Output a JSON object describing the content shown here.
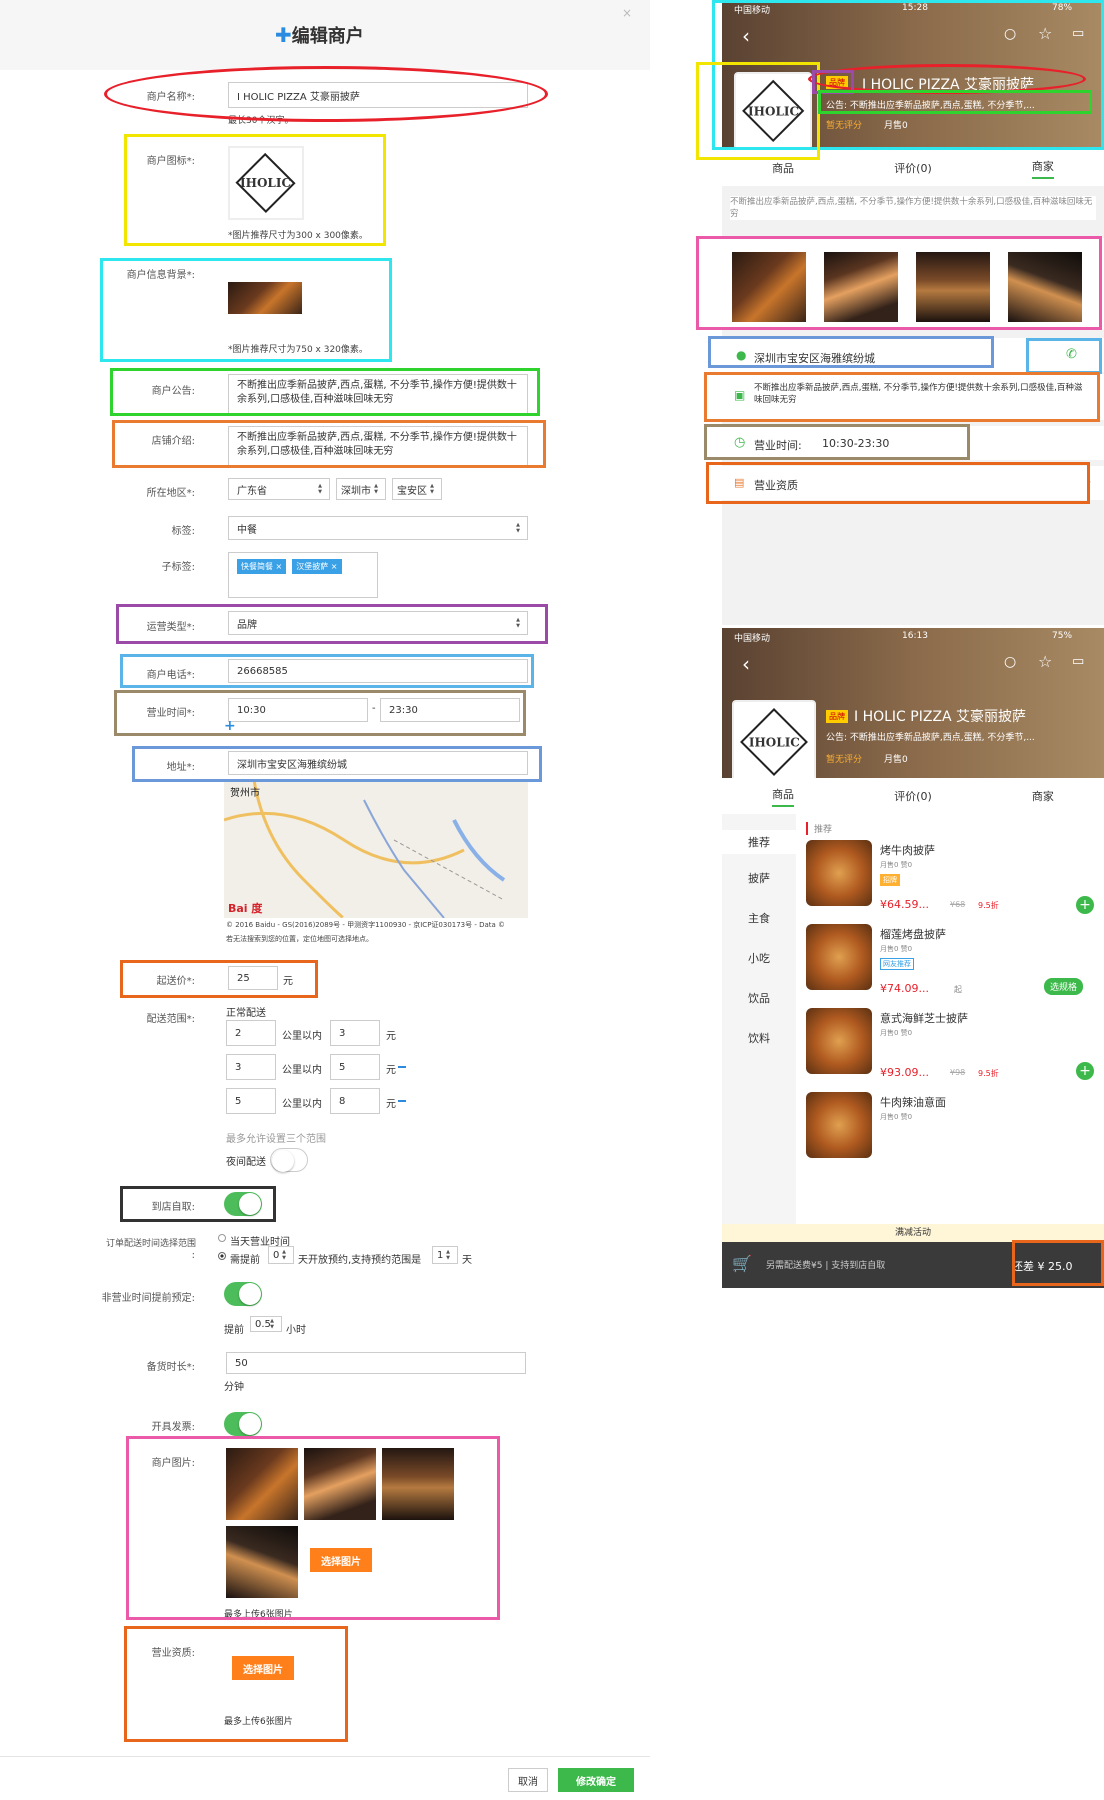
{
  "form": {
    "title": "编辑商户",
    "close": "×",
    "name_label": "商户名称*:",
    "name_value": "I HOLIC PIZZA 艾豪丽披萨",
    "name_hint": "最长30个汉字。",
    "icon_label": "商户图标*:",
    "icon_hint": "*图片推荐尺寸为300 x 300像素。",
    "bg_label": "商户信息背景*:",
    "bg_hint": "*图片推荐尺寸为750 x 320像素。",
    "notice_label": "商户公告:",
    "notice_value": "不断推出应季新品披萨,西点,蛋糕, 不分季节,操作方便!提供数十余系列,口感极佳,百种滋味回味无穷",
    "intro_label": "店铺介绍:",
    "intro_value": "不断推出应季新品披萨,西点,蛋糕, 不分季节,操作方便!提供数十余系列,口感极佳,百种滋味回味无穷",
    "region_label": "所在地区*:",
    "province": "广东省",
    "city": "深圳市",
    "district": "宝安区",
    "tag_label": "标签:",
    "tag_value": "中餐",
    "subtag_label": "子标签:",
    "subtag1": "快餐简餐",
    "subtag2": "汉堡披萨",
    "optype_label": "运营类型*:",
    "optype_value": "品牌",
    "phone_label": "商户电话*:",
    "phone_value": "26668585",
    "hours_label": "营业时间*:",
    "hours_start": "10:30",
    "hours_sep": "-",
    "hours_end": "23:30",
    "hours_add": "+",
    "addr_label": "地址*:",
    "addr_value": "深圳市宝安区海雅缤纷城",
    "map_city": "贺州市",
    "map_copyright": "© 2016 Baidu - GS(2016)2089号 - 甲测资字1100930 - 京ICP证030173号 - Data ©",
    "map_hint": "若无法搜索到您的位置，定位地图可选择地点。",
    "map_logo": "Bai 度",
    "minprice_label": "起送价*:",
    "minprice_value": "25",
    "yuan": "元",
    "range_label": "配送范围*:",
    "range_mode": "正常配送",
    "km_label": "公里以内",
    "ranges": [
      {
        "km": "2",
        "fee": "3"
      },
      {
        "km": "3",
        "fee": "5"
      },
      {
        "km": "5",
        "fee": "8"
      }
    ],
    "range_hint": "最多允许设置三个范围",
    "night_label": "夜间配送",
    "pickup_label": "到店自取:",
    "time_label": "订单配送时间选择范围",
    "time_label2": ":",
    "time_opt1": "当天营业时间",
    "time_opt2a": "需提前",
    "time_opt2_val": "0",
    "time_opt2b": "天开放预约,支持预约范围是",
    "time_opt2_val2": "1",
    "time_opt2c": "天",
    "preorder_label": "非营业时间提前预定:",
    "preorder_prefix": "提前",
    "preorder_val": "0.5",
    "preorder_unit": "小时",
    "prep_label": "备货时长*:",
    "prep_value": "50",
    "prep_unit": "分钟",
    "invoice_label": "开具发票:",
    "photos_label": "商户图片:",
    "choose_img": "选择图片",
    "photos_hint": "最多上传6张图片",
    "license_label": "营业资质:",
    "license_hint": "最多上传6张图片",
    "cancel": "取消",
    "confirm": "修改确定"
  },
  "phone1": {
    "carrier": "中国移动",
    "time": "15:28",
    "battery": "78%",
    "brand_badge": "品牌",
    "name": "I HOLIC PIZZA 艾豪丽披萨",
    "notice": "公告: 不断推出应季新品披萨,西点,蛋糕, 不分季节,...",
    "rating": "暂无评分",
    "sales": "月售0",
    "tabs": [
      "商品",
      "评价(0)",
      "商家"
    ],
    "intro": "不断推出应季新品披萨,西点,蛋糕, 不分季节,操作方便!提供数十余系列,口感极佳,百种滋味回味无穷",
    "address": "深圳市宝安区海雅缤纷城",
    "intro2": "不断推出应季新品披萨,西点,蛋糕, 不分季节,操作方便!提供数十余系列,口感极佳,百种滋味回味无穷",
    "hours_label": "营业时间:",
    "hours": "10:30-23:30",
    "license": "营业资质"
  },
  "phone2": {
    "carrier": "中国移动",
    "time": "16:13",
    "battery": "75%",
    "brand_badge": "品牌",
    "name": "I HOLIC PIZZA 艾豪丽披萨",
    "notice": "公告: 不断推出应季新品披萨,西点,蛋糕, 不分季节,...",
    "rating": "暂无评分",
    "sales": "月售0",
    "tabs": [
      "商品",
      "评价(0)",
      "商家"
    ],
    "categories": [
      "推荐",
      "披萨",
      "主食",
      "小吃",
      "饮品",
      "饮料"
    ],
    "section": "推荐",
    "items": [
      {
        "name": "烤牛肉披萨",
        "meta": "月售0  赞0",
        "badge": "招牌",
        "price": "¥64.59...",
        "orig": "¥68",
        "discount": "9.5折"
      },
      {
        "name": "榴莲烤盘披萨",
        "meta": "月售0  赞0",
        "badge": "网友推荐",
        "price": "¥74.09...",
        "orig": "起",
        "discount": "",
        "btn": "选规格"
      },
      {
        "name": "意式海鲜芝士披萨",
        "meta": "月售0  赞0",
        "badge": "",
        "price": "¥93.09...",
        "orig": "¥98",
        "discount": "9.5折"
      },
      {
        "name": "牛肉辣油意面",
        "meta": "月售0  赞0",
        "badge": "",
        "price": "",
        "orig": "",
        "discount": ""
      }
    ],
    "promo": "满减活动",
    "cart_text": "另需配送费¥5 | 支持到店自取",
    "checkout": "还差 ¥ 25.0"
  },
  "colors": {
    "red": "#e8202a",
    "yellow": "#f2e500",
    "cyan": "#2ee6ee",
    "green": "#2ed32e",
    "orange": "#ea7a30",
    "purple": "#9b4aa8",
    "lightblue": "#5ab4e8",
    "brown": "#9a8a6a",
    "blue": "#6a98d8",
    "pink": "#ea5aa8",
    "dark": "#333333",
    "darkorange": "#e8661c"
  }
}
